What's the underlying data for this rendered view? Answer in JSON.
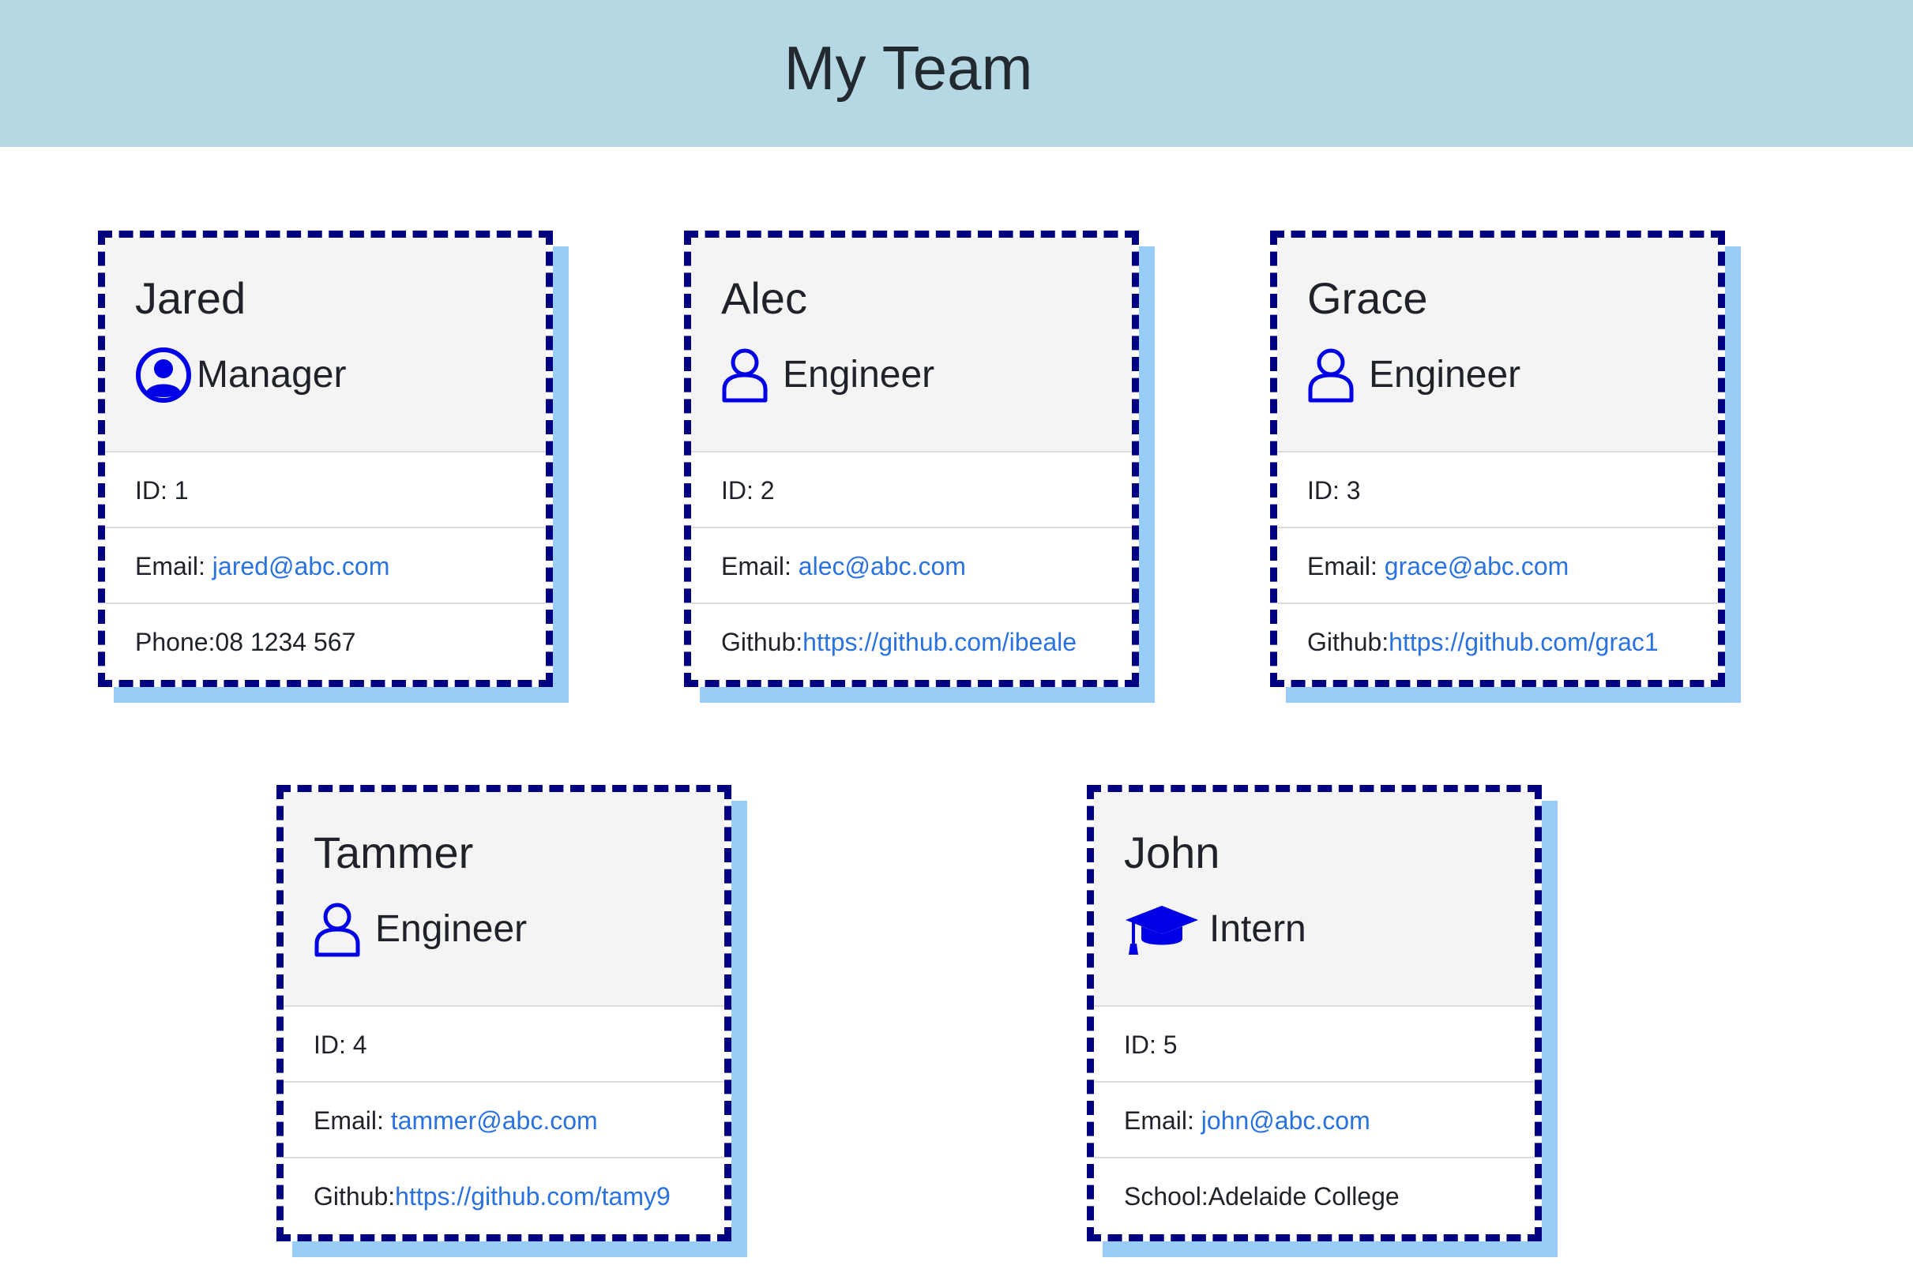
{
  "page_title": "My Team",
  "colors": {
    "header_bg": "#b5d8e4",
    "card_border": "#000080",
    "card_shadow": "#99ccf7",
    "icon_blue": "#0000e6",
    "link": "#2a72e0"
  },
  "employees": [
    {
      "name": "Jared",
      "role": "Manager",
      "icon": "user-circle-icon",
      "id_text": "ID: 1",
      "email_label": "Email: ",
      "email": "jared@abc.com",
      "extra_label": "Phone:",
      "extra_value": "08 1234 567"
    },
    {
      "name": "Alec",
      "role": "Engineer",
      "icon": "user-outline-icon",
      "id_text": "ID: 2",
      "email_label": "Email: ",
      "email": "alec@abc.com",
      "extra_label": "Github:",
      "extra_value": "https://github.com/ibeale"
    },
    {
      "name": "Grace",
      "role": "Engineer",
      "icon": "user-outline-icon",
      "id_text": "ID: 3",
      "email_label": "Email: ",
      "email": "grace@abc.com",
      "extra_label": "Github:",
      "extra_value": "https://github.com/grac1"
    },
    {
      "name": "Tammer",
      "role": "Engineer",
      "icon": "user-outline-icon",
      "id_text": "ID: 4",
      "email_label": "Email: ",
      "email": "tammer@abc.com",
      "extra_label": "Github:",
      "extra_value": "https://github.com/tamy9"
    },
    {
      "name": "John",
      "role": "Intern",
      "icon": "graduation-cap-icon",
      "id_text": "ID: 5",
      "email_label": "Email: ",
      "email": "john@abc.com",
      "extra_label": "School:",
      "extra_value": "Adelaide College"
    }
  ]
}
